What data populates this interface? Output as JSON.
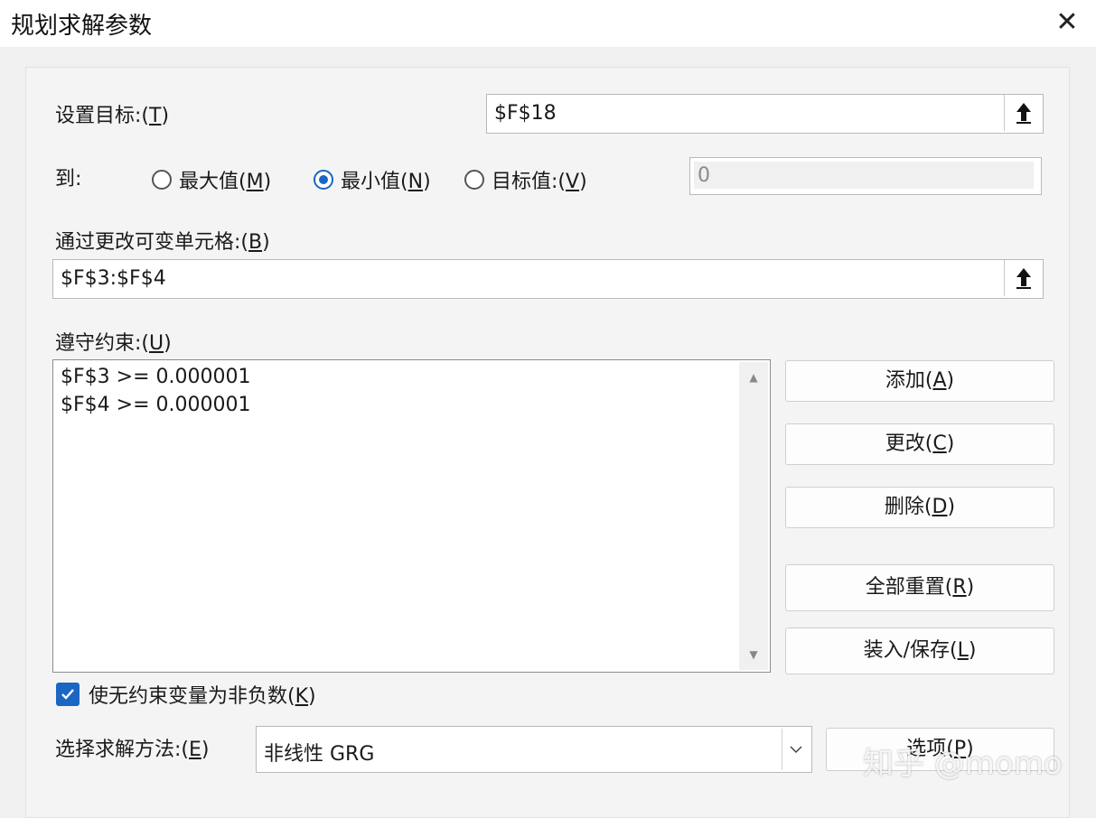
{
  "window": {
    "title": "规划求解参数",
    "close_symbol": "✕"
  },
  "objective": {
    "label": "设置目标:(",
    "accel": "T",
    "label_end": ")",
    "value": "$F$18"
  },
  "to": {
    "label": "到:",
    "options": [
      {
        "text": "最大值(",
        "accel": "M",
        "end": ")",
        "selected": false
      },
      {
        "text": "最小值(",
        "accel": "N",
        "end": ")",
        "selected": true
      },
      {
        "text": "目标值:(",
        "accel": "V",
        "end": ")",
        "selected": false
      }
    ],
    "target_value": "0"
  },
  "changing_cells": {
    "label": "通过更改可变单元格:(",
    "accel": "B",
    "label_end": ")",
    "value": "$F$3:$F$4"
  },
  "constraints": {
    "label": "遵守约束:(",
    "accel": "U",
    "label_end": ")",
    "items": [
      "$F$3 >= 0.000001",
      "$F$4 >= 0.000001"
    ]
  },
  "buttons": {
    "add": {
      "text": "添加(",
      "accel": "A",
      "end": ")"
    },
    "change": {
      "text": "更改(",
      "accel": "C",
      "end": ")"
    },
    "delete": {
      "text": "删除(",
      "accel": "D",
      "end": ")"
    },
    "reset_all": {
      "text": "全部重置(",
      "accel": "R",
      "end": ")"
    },
    "load_save": {
      "text": "装入/保存(",
      "accel": "L",
      "end": ")"
    },
    "options": {
      "text": "选项(",
      "accel": "P",
      "end": ")"
    }
  },
  "nonneg": {
    "text": "使无约束变量为非负数(",
    "accel": "K",
    "end": ")",
    "checked": true
  },
  "method": {
    "label": "选择求解方法:(",
    "accel": "E",
    "label_end": ")",
    "value": "非线性 GRG"
  },
  "watermark": "知乎 @momo",
  "colors": {
    "accent": "#1b66c2"
  }
}
